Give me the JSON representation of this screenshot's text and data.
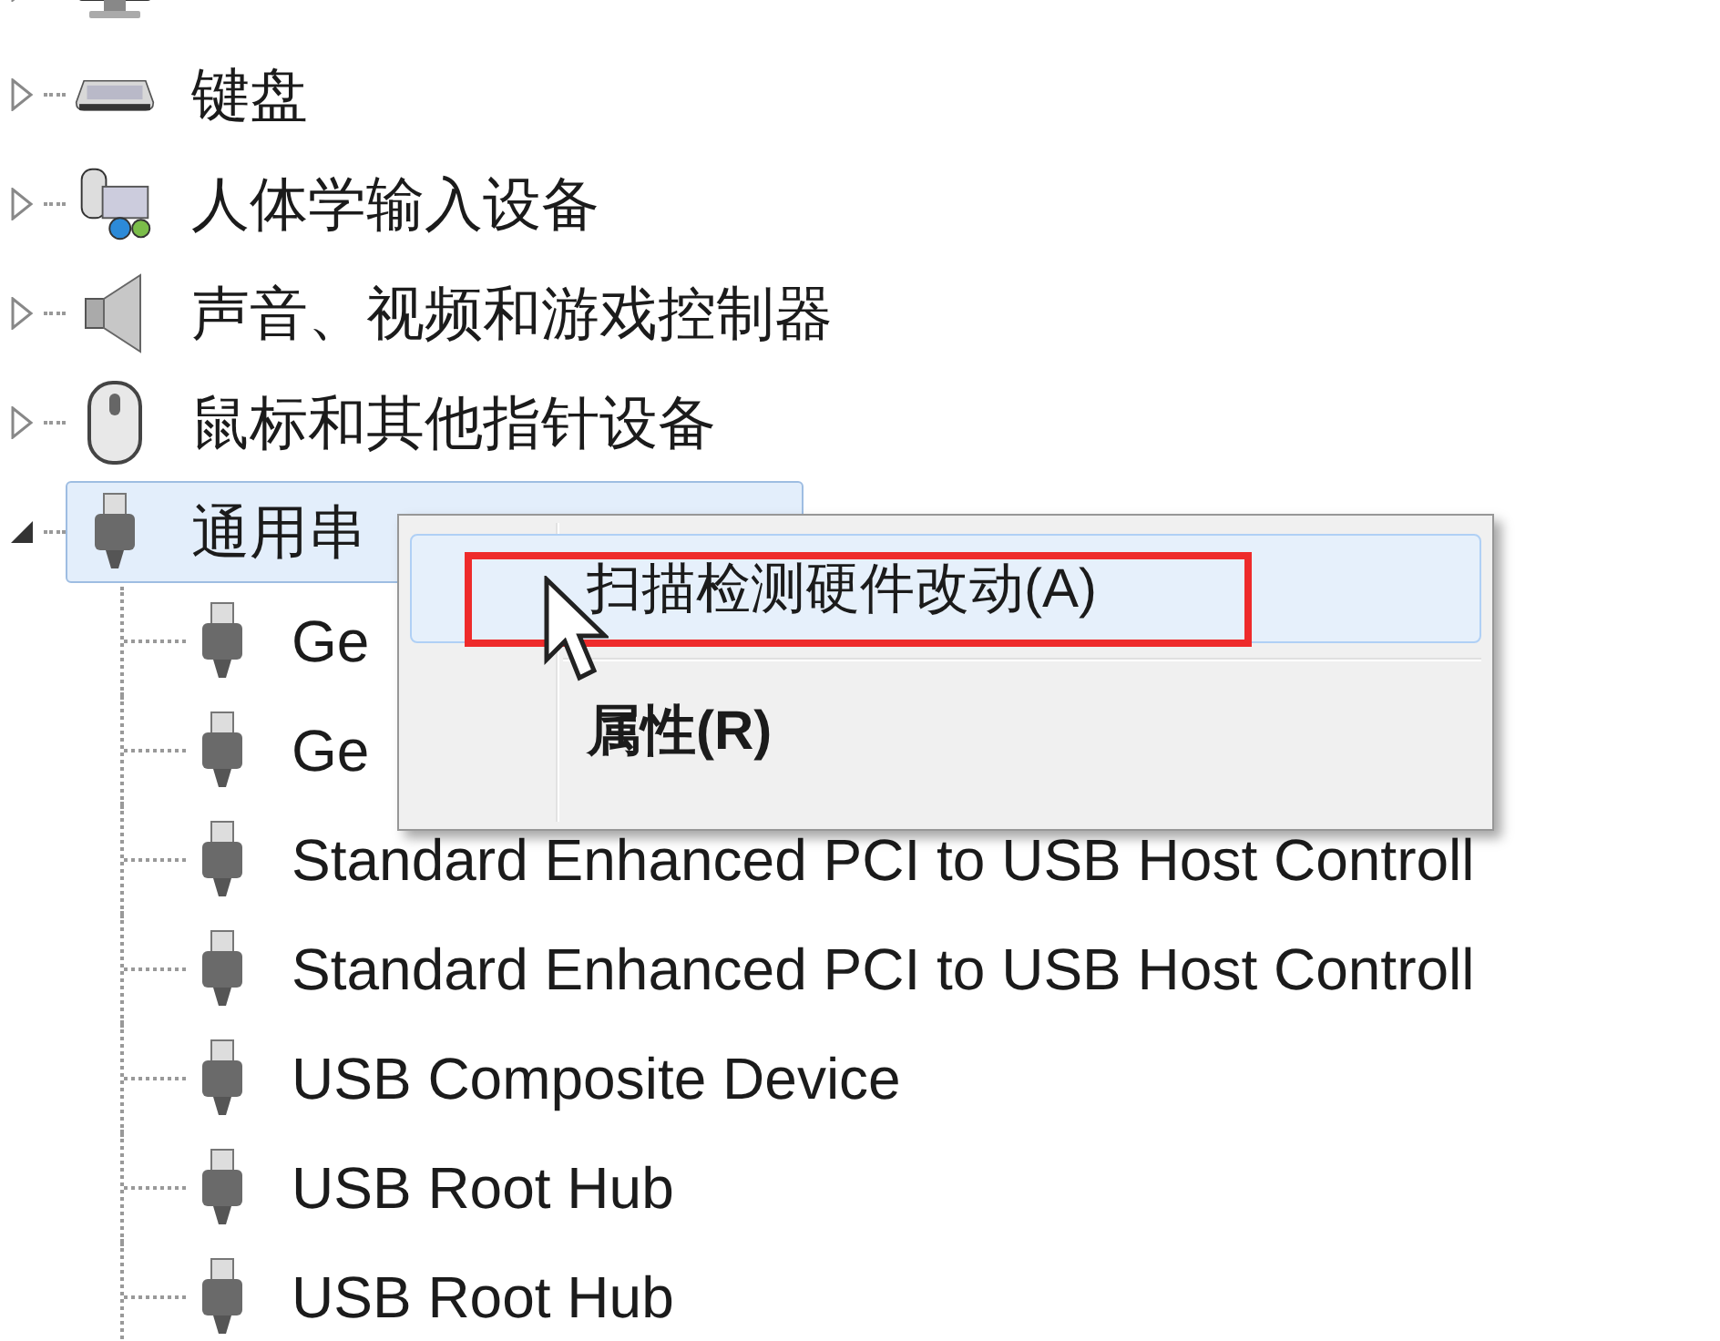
{
  "tree": [
    {
      "kind": "monitor",
      "expanded": false,
      "selected": false
    },
    {
      "label": "键盘",
      "kind": "keyboard",
      "expanded": false,
      "selected": false
    },
    {
      "label": "人体学输入设备",
      "kind": "hid",
      "expanded": false,
      "selected": false
    },
    {
      "label": "声音、视频和游戏控制器",
      "kind": "speaker",
      "expanded": false,
      "selected": false
    },
    {
      "label": "鼠标和其他指针设备",
      "kind": "mouse",
      "expanded": false,
      "selected": false
    },
    {
      "label": "通用串",
      "kind": "usb",
      "expanded": true,
      "selected": true,
      "children": [
        {
          "label": "Ge",
          "kind": "usb"
        },
        {
          "label": "Ge",
          "kind": "usb"
        },
        {
          "label": "Standard Enhanced PCI to USB Host Controll",
          "kind": "usb"
        },
        {
          "label": "Standard Enhanced PCI to USB Host Controll",
          "kind": "usb"
        },
        {
          "label": "USB Composite Device",
          "kind": "usb"
        },
        {
          "label": "USB Root Hub",
          "kind": "usb"
        },
        {
          "label": "USB Root Hub",
          "kind": "usb"
        }
      ]
    }
  ],
  "context_menu": {
    "items": [
      {
        "label": "扫描检测硬件改动(A)",
        "highlighted": true,
        "bold": false,
        "annotated": true
      },
      {
        "label": "属性(R)",
        "highlighted": false,
        "bold": true,
        "annotated": false
      }
    ]
  }
}
